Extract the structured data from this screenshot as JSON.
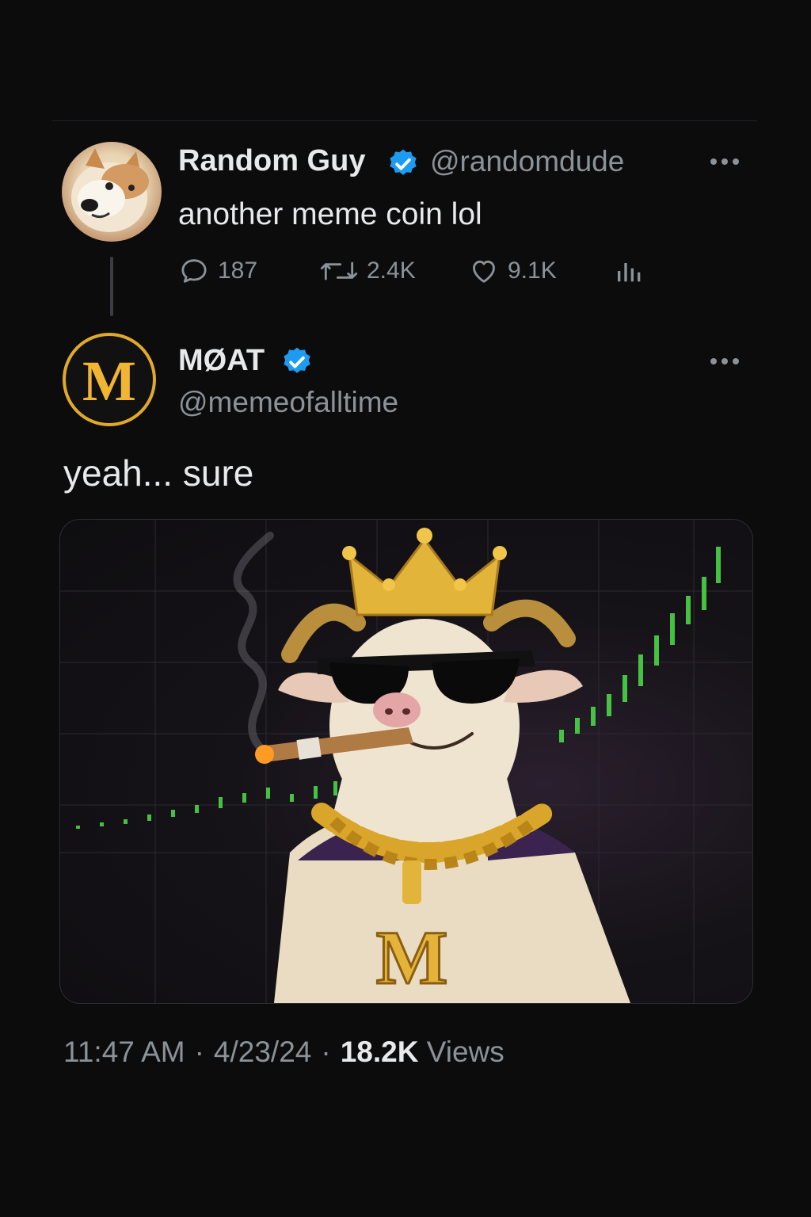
{
  "parent_tweet": {
    "display_name": "Random Guy",
    "handle": "@randomdude",
    "text": "another meme coin lol",
    "reply_count": "187",
    "retweet_count": "2.4K",
    "like_count": "9.1K",
    "avatar_icon": "shiba-dog-avatar",
    "verified": true
  },
  "reply_tweet": {
    "display_name": "MØAT",
    "handle": "@memeofalltime",
    "text": "yeah... sure",
    "avatar_letter": "M",
    "verified": true,
    "media_label": "M",
    "time": "11:47 AM",
    "date": "4/23/24",
    "view_count": "18.2K",
    "views_label": "Views"
  },
  "colors": {
    "background": "#0c0c0d",
    "verified_blue": "#1d9bf0",
    "secondary_text": "#8b9298",
    "gold": "#e1a92c"
  }
}
